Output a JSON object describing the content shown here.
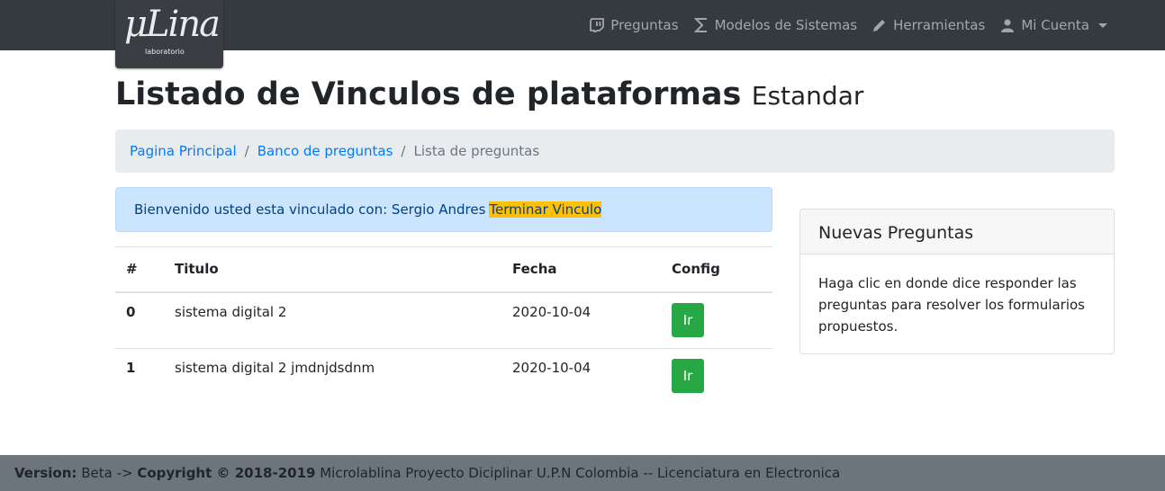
{
  "logo": {
    "main": "μLina",
    "sub": "laboratorio"
  },
  "nav": {
    "items": [
      {
        "label": "Preguntas",
        "icon": "twitch-chat-icon"
      },
      {
        "label": "Modelos de Sistemas",
        "icon": "sigma-icon"
      },
      {
        "label": "Herramientas",
        "icon": "pencil-icon"
      },
      {
        "label": "Mi Cuenta",
        "icon": "user-icon"
      }
    ]
  },
  "page": {
    "title": "Listado de Vinculos de plataformas",
    "subtitle": "Estandar"
  },
  "breadcrumb": {
    "items": [
      "Pagina Principal",
      "Banco de preguntas"
    ],
    "active": "Lista de preguntas",
    "separator": "/"
  },
  "alert": {
    "text": "Bienvenido usted esta vinculado con: Sergio Andres",
    "link": "Terminar Vinculo"
  },
  "table": {
    "headers": [
      "#",
      "Titulo",
      "Fecha",
      "Config"
    ],
    "rows": [
      {
        "idx": "0",
        "title": "sistema digital 2",
        "date": "2020-10-04",
        "button": "Ir"
      },
      {
        "idx": "1",
        "title": "sistema digital 2 jmdnjdsdnm",
        "date": "2020-10-04",
        "button": "Ir"
      }
    ]
  },
  "card": {
    "header": "Nuevas Preguntas",
    "body": "Haga clic en donde dice responder las preguntas para resolver los formularios propuestos."
  },
  "footer": {
    "version_label": "Version:",
    "version_value": "Beta ->",
    "copyright": "Copyright © 2018-2019",
    "text": "Microlablina Proyecto Diciplinar U.P.N Colombia -- Licenciatura en Electronica"
  },
  "colors": {
    "navbar": "#343a40",
    "link": "#007bff",
    "alert_bg": "#cce5ff",
    "highlight": "#ffc107",
    "button": "#28a745",
    "footer": "#6c757d"
  }
}
